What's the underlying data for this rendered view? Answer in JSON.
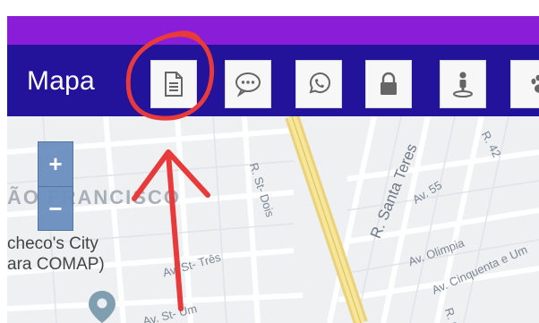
{
  "app_bar": {
    "title": "Mapa",
    "buttons": [
      {
        "name": "document",
        "icon": "document-icon"
      },
      {
        "name": "chat",
        "icon": "chat-bubble-icon"
      },
      {
        "name": "whatsapp",
        "icon": "whatsapp-icon"
      },
      {
        "name": "lock",
        "icon": "lock-icon"
      },
      {
        "name": "person",
        "icon": "person-pin-icon"
      },
      {
        "name": "paw",
        "icon": "paw-icon"
      }
    ]
  },
  "map": {
    "district_label": "ÃO FRANCISCO",
    "poi_label_line1": "checo's City",
    "poi_label_line2": "ara COMAP)",
    "streets": {
      "santa_teresa": "R. Santa Teres",
      "st_dois": "R. St- Dois",
      "av_55": "Av. 55",
      "r_42": "R. 42",
      "av_st_tres": "Av. St- Três",
      "av_st_um": "Av. St- Um",
      "av_olimpia": "Av. Olimpia",
      "av_cinquenta": "Av. Cinquenta e Um",
      "r_o": "R. O"
    },
    "zoom_in": "+",
    "zoom_out": "−"
  },
  "colors": {
    "status_bar": "#8a1ed8",
    "app_bar": "#23139a",
    "map_bg": "#eef0f2",
    "highway": "#f2dc7a",
    "annotation": "#e83a3a",
    "zoom_control": "#6b8fbf"
  }
}
